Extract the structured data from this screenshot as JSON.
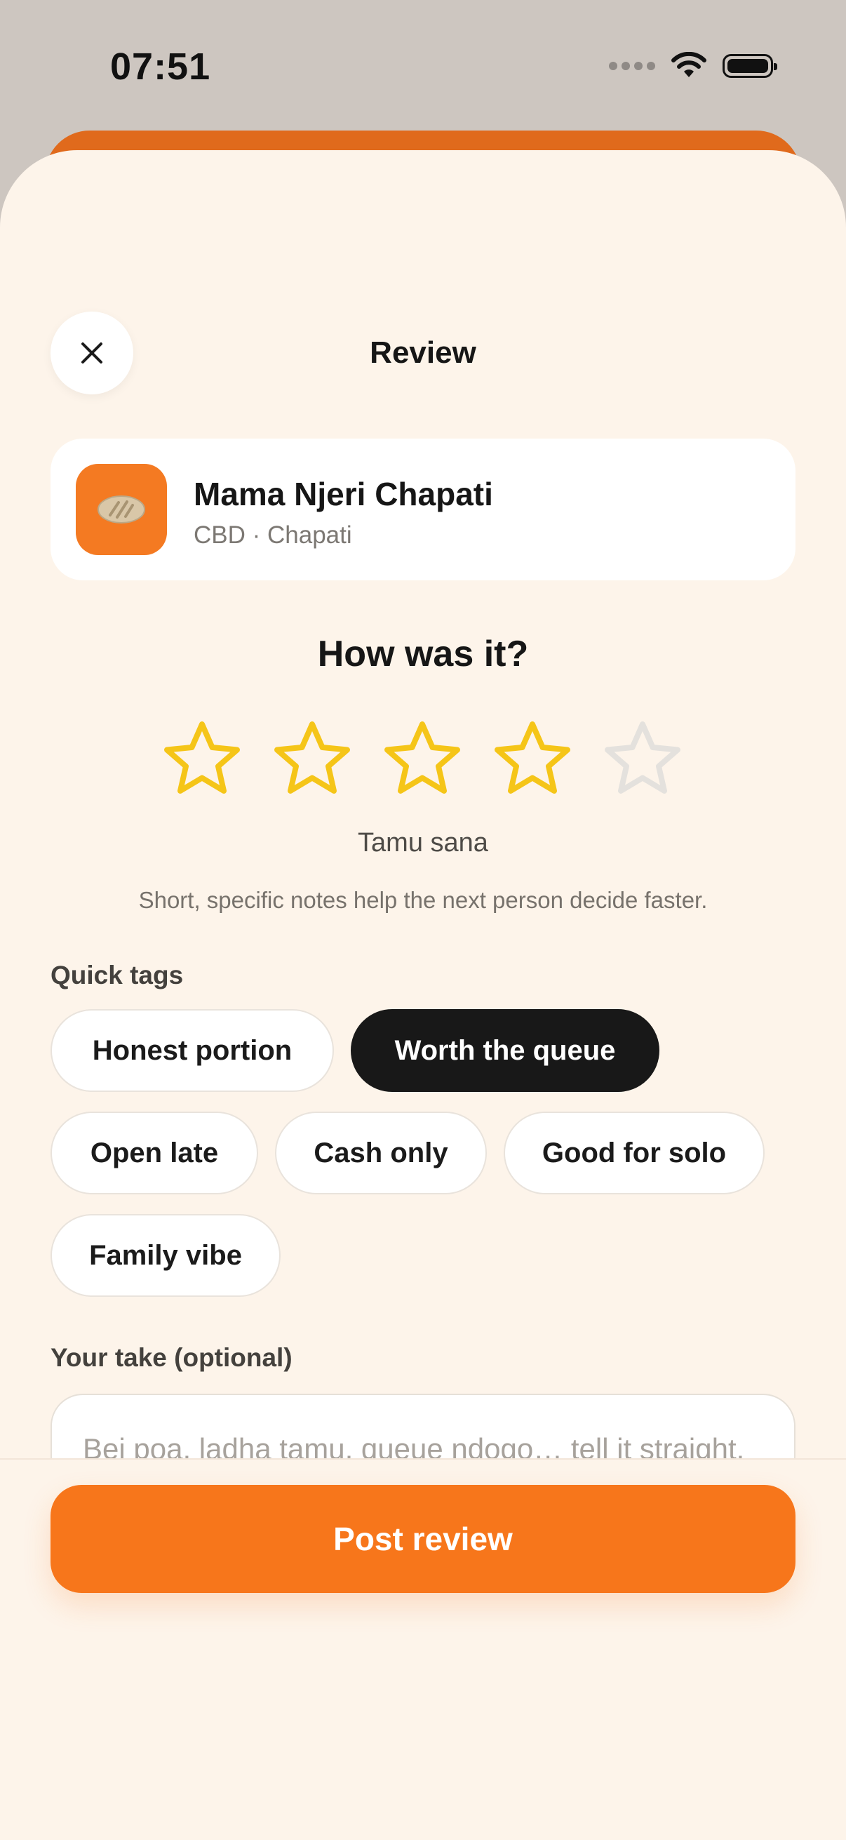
{
  "status_bar": {
    "time": "07:51"
  },
  "header": {
    "title": "Review"
  },
  "place": {
    "name": "Mama Njeri Chapati",
    "subtitle": "CBD · Chapati"
  },
  "rating": {
    "question": "How was it?",
    "value": 4,
    "max": 5,
    "label": "Tamu sana",
    "hint": "Short, specific notes help the next person decide faster."
  },
  "tags": {
    "label": "Quick tags",
    "items": [
      {
        "label": "Honest portion",
        "selected": false
      },
      {
        "label": "Worth the queue",
        "selected": true
      },
      {
        "label": "Open late",
        "selected": false
      },
      {
        "label": "Cash only",
        "selected": false
      },
      {
        "label": "Good for solo",
        "selected": false
      },
      {
        "label": "Family vibe",
        "selected": false
      }
    ]
  },
  "take": {
    "label": "Your take (optional)",
    "placeholder": "Bei poa, ladha tamu, queue ndogo… tell it straight.",
    "value": ""
  },
  "actions": {
    "post_label": "Post review"
  },
  "colors": {
    "accent": "#f7761b",
    "star_filled": "#f5c518",
    "star_empty": "#e4e1dd",
    "selected_tag": "#181818",
    "background": "#fdf4ea"
  }
}
